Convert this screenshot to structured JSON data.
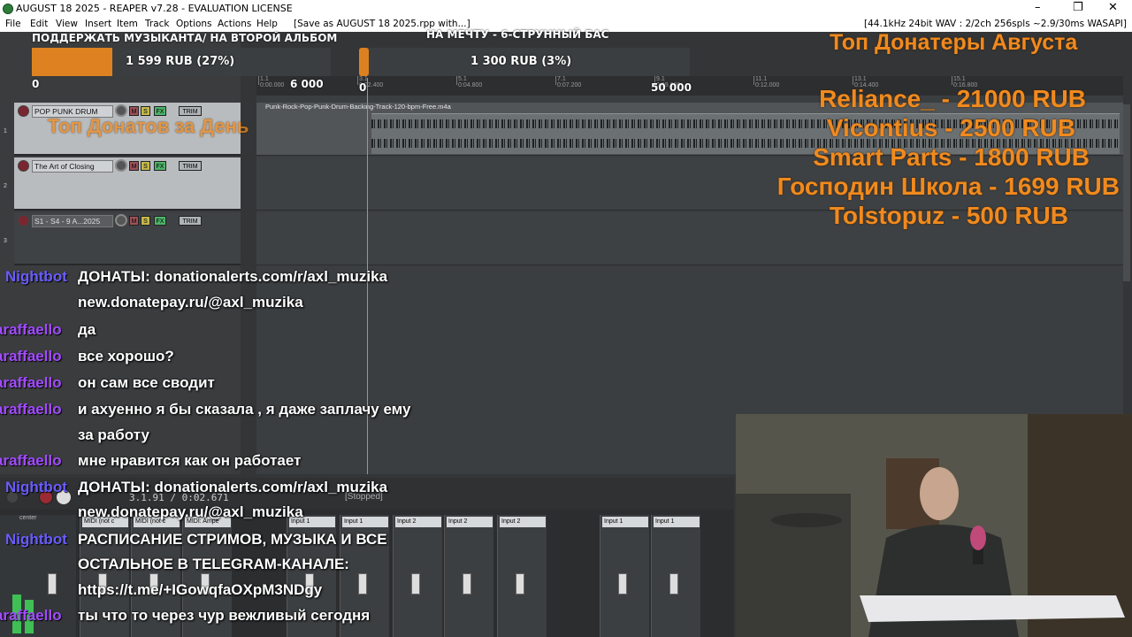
{
  "window": {
    "title": "AUGUST 18 2025 - REAPER v7.28 - EVALUATION LICENSE",
    "minimize": "–",
    "maximize": "❐",
    "close": "✕"
  },
  "menu": {
    "items": [
      "File",
      "Edit",
      "View",
      "Insert",
      "Item",
      "Track",
      "Options",
      "Actions",
      "Help"
    ],
    "save_hint": "[Save as AUGUST 18 2025.rpp with...]",
    "audio_status": "[44.1kHz 24bit WAV : 2/2ch 256spls ~2.9/30ms WASAPI]"
  },
  "donation_goals": [
    {
      "title": "ПОДДЕРЖАТЬ МУЗЫКАНТА/ НА ВТОРОЙ АЛЬБОМ",
      "amount_text": "1 599 RUB (27%)",
      "progress": 0.27,
      "start": "0",
      "target": "6 000"
    },
    {
      "title": "НА МЕЧТУ - 6-СТРУННЫЙ БАС",
      "amount_text": "1 300 RUB (3%)",
      "progress": 0.03,
      "start": "0",
      "target": "50 000"
    }
  ],
  "top_day_label": "Топ Донатов за День",
  "top_month": {
    "heading": "Топ Донатеры Августа",
    "donors": [
      "Reliance_ - 21000 RUB",
      "Vicontius - 2500 RUB",
      "Smart Parts - 1800 RUB",
      "Господин Школа - 1699 RUB",
      "Tolstopuz - 500 RUB"
    ]
  },
  "ruler": [
    {
      "bar": "1.1",
      "time": "0:00.000"
    },
    {
      "bar": "3.1",
      "time": "0:02.400"
    },
    {
      "bar": "5.1",
      "time": "0:04.800"
    },
    {
      "bar": "7.1",
      "time": "0:07.200"
    },
    {
      "bar": "9.1",
      "time": "0:09.600"
    },
    {
      "bar": "11.1",
      "time": "0:12.000"
    },
    {
      "bar": "13.1",
      "time": "0:14.400"
    },
    {
      "bar": "15.1",
      "time": "0:16.800"
    }
  ],
  "tracks": [
    {
      "num": "1",
      "name": "POP PUNK DRUM"
    },
    {
      "num": "2",
      "name": "The Art of Closing"
    },
    {
      "num": "3",
      "name": "S1 - S4 - 9 A...2025"
    }
  ],
  "track_buttons": {
    "mute": "M",
    "solo": "S",
    "fx": "FX",
    "trim": "TRIM"
  },
  "item_name": "Punk-Rock-Pop-Punk-Drum-Backing-Track-120-bpm-Free.m4a",
  "chat": [
    {
      "user": "Nightbot",
      "type": "bot",
      "lines": [
        "ДОНАТЫ: donationalerts.com/r/axl_muzika",
        "new.donatepay.ru/@axl_muzika"
      ]
    },
    {
      "user": "araffaello",
      "type": "raf",
      "lines": [
        "да"
      ]
    },
    {
      "user": "araffaello",
      "type": "raf",
      "lines": [
        "все хорошо?"
      ]
    },
    {
      "user": "araffaello",
      "type": "raf",
      "lines": [
        "он сам все сводит"
      ]
    },
    {
      "user": "araffaello",
      "type": "raf",
      "lines": [
        "и ахуенно я бы сказала , я даже заплачу ему",
        "за работу"
      ]
    },
    {
      "user": "araffaello",
      "type": "raf",
      "lines": [
        "мне нравится как он работает"
      ]
    },
    {
      "user": "Nightbot",
      "type": "bot",
      "lines": [
        "ДОНАТЫ: donationalerts.com/r/axl_muzika",
        "new.donatepay.ru/@axl_muzika"
      ]
    },
    {
      "user": "Nightbot",
      "type": "bot",
      "lines": [
        "РАСПИСАНИЕ СТРИМОВ, МУЗЫКА И ВСЕ",
        "ОСТАЛЬНОЕ В TELEGRAM-КАНАЛЕ:",
        "https://t.me/+IGowqfaOXpM3NDgy"
      ]
    },
    {
      "user": "araffaello",
      "type": "raf",
      "lines": [
        "ты что то через чур вежливый сегодня"
      ]
    }
  ],
  "transport": {
    "time": "3.1.91 / 0:02.671",
    "state": "[Stopped]"
  },
  "mixer": {
    "inputs": [
      "MIDI (not c",
      "MIDI (not c",
      "MIDI: Ampe",
      "Input 1",
      "Input 1",
      "Input 2",
      "Input 2",
      "Input 2",
      "Input 1",
      "Input 1"
    ],
    "master_label": "center"
  },
  "colors": {
    "accent_orange": "#f08a1e",
    "nightbot": "#6a5cff",
    "raffaello": "#a24bff",
    "playhead": "#3fc2a0"
  }
}
